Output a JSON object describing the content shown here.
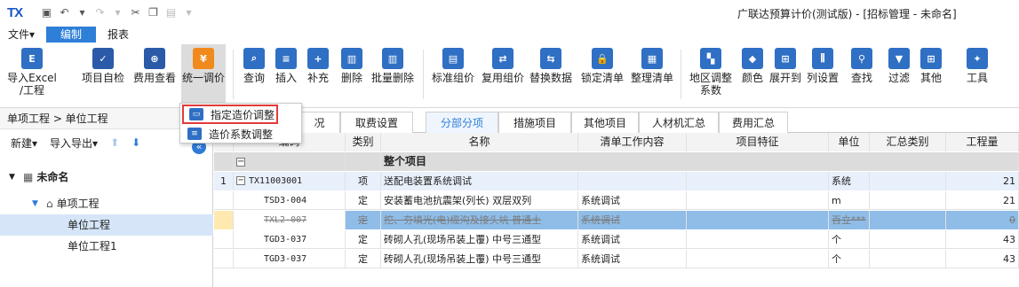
{
  "app": {
    "logo": "TX",
    "title": "广联达预算计价(测试版) - [招标管理 - 未命名]"
  },
  "menu": {
    "file": "文件▾",
    "edit": "编制",
    "report": "报表"
  },
  "ribbon": [
    {
      "id": "import",
      "label1": "导入Excel",
      "label2": "/工程",
      "icon": "excel-import-icon"
    },
    {
      "id": "selfcheck",
      "label1": "项目自检",
      "label2": "",
      "icon": "project-check-icon"
    },
    {
      "id": "fee",
      "label1": "费用查看",
      "label2": "",
      "icon": "fee-view-icon"
    },
    {
      "id": "unify",
      "label1": "统一调价",
      "label2": "",
      "icon": "unify-price-icon"
    },
    {
      "id": "query",
      "label1": "查询",
      "label2": "",
      "icon": "query-icon"
    },
    {
      "id": "insert",
      "label1": "插入",
      "label2": "",
      "icon": "insert-icon"
    },
    {
      "id": "supplement",
      "label1": "补充",
      "label2": "",
      "icon": "supplement-icon"
    },
    {
      "id": "delete",
      "label1": "删除",
      "label2": "",
      "icon": "delete-icon"
    },
    {
      "id": "batchdel",
      "label1": "批量删除",
      "label2": "",
      "icon": "batch-delete-icon"
    },
    {
      "id": "stdgroup",
      "label1": "标准组价",
      "label2": "",
      "icon": "standard-group-icon"
    },
    {
      "id": "reuse",
      "label1": "复用组价",
      "label2": "",
      "icon": "reuse-group-icon"
    },
    {
      "id": "replace",
      "label1": "替换数据",
      "label2": "",
      "icon": "replace-data-icon"
    },
    {
      "id": "lock",
      "label1": "锁定清单",
      "label2": "",
      "icon": "lock-list-icon"
    },
    {
      "id": "tidy",
      "label1": "整理清单",
      "label2": "",
      "icon": "tidy-list-icon"
    },
    {
      "id": "region",
      "label1": "地区调整",
      "label2": "系数",
      "icon": "region-adjust-icon"
    },
    {
      "id": "color",
      "label1": "颜色",
      "label2": "",
      "icon": "color-icon"
    },
    {
      "id": "expand",
      "label1": "展开到",
      "label2": "",
      "icon": "expand-to-icon"
    },
    {
      "id": "cols",
      "label1": "列设置",
      "label2": "",
      "icon": "column-settings-icon"
    },
    {
      "id": "find",
      "label1": "查找",
      "label2": "",
      "icon": "find-icon"
    },
    {
      "id": "filter",
      "label1": "过滤",
      "label2": "",
      "icon": "filter-icon"
    },
    {
      "id": "other",
      "label1": "其他",
      "label2": "",
      "icon": "other-icon"
    },
    {
      "id": "tools",
      "label1": "工具",
      "label2": "",
      "icon": "tools-icon"
    }
  ],
  "dropdown": {
    "item1": "指定造价调整",
    "item2": "造价系数调整"
  },
  "left": {
    "breadcrumb": "单项工程 > 单位工程",
    "new": "新建▾",
    "import_export": "导入导出▾",
    "tree": {
      "root": "未命名",
      "sub": "单项工程",
      "unit": "单位工程",
      "unit1": "单位工程1"
    }
  },
  "tabs": [
    "况",
    "取费设置",
    "分部分项",
    "措施项目",
    "其他项目",
    "人材机汇总",
    "费用汇总"
  ],
  "grid": {
    "headers": [
      "编码",
      "类别",
      "名称",
      "清单工作内容",
      "项目特征",
      "单位",
      "汇总类别",
      "工程量"
    ],
    "group_label": "整个项目",
    "rows": [
      {
        "no": "1",
        "code": "TX11003001",
        "type": "项",
        "name": "送配电装置系统调试",
        "work": "",
        "unit": "系统",
        "qty": "21"
      },
      {
        "no": "",
        "code": "TSD3-004",
        "type": "定",
        "name": "安装蓄电池抗震架(列长) 双层双列",
        "work": "系统调试",
        "unit": "m",
        "qty": "21"
      },
      {
        "no": "",
        "code": "TXL2-007",
        "type": "定",
        "name": "挖、夯填光(电)缆沟及接头坑 普通土",
        "work": "系统调试",
        "unit": "百立***",
        "qty": "0"
      },
      {
        "no": "",
        "code": "TGD3-037",
        "type": "定",
        "name": "砖砌人孔(现场吊装上覆) 中号三通型",
        "work": "系统调试",
        "unit": "个",
        "qty": "43"
      },
      {
        "no": "",
        "code": "TGD3-037",
        "type": "定",
        "name": "砖砌人孔(现场吊装上覆) 中号三通型",
        "work": "系统调试",
        "unit": "个",
        "qty": "43"
      }
    ]
  }
}
